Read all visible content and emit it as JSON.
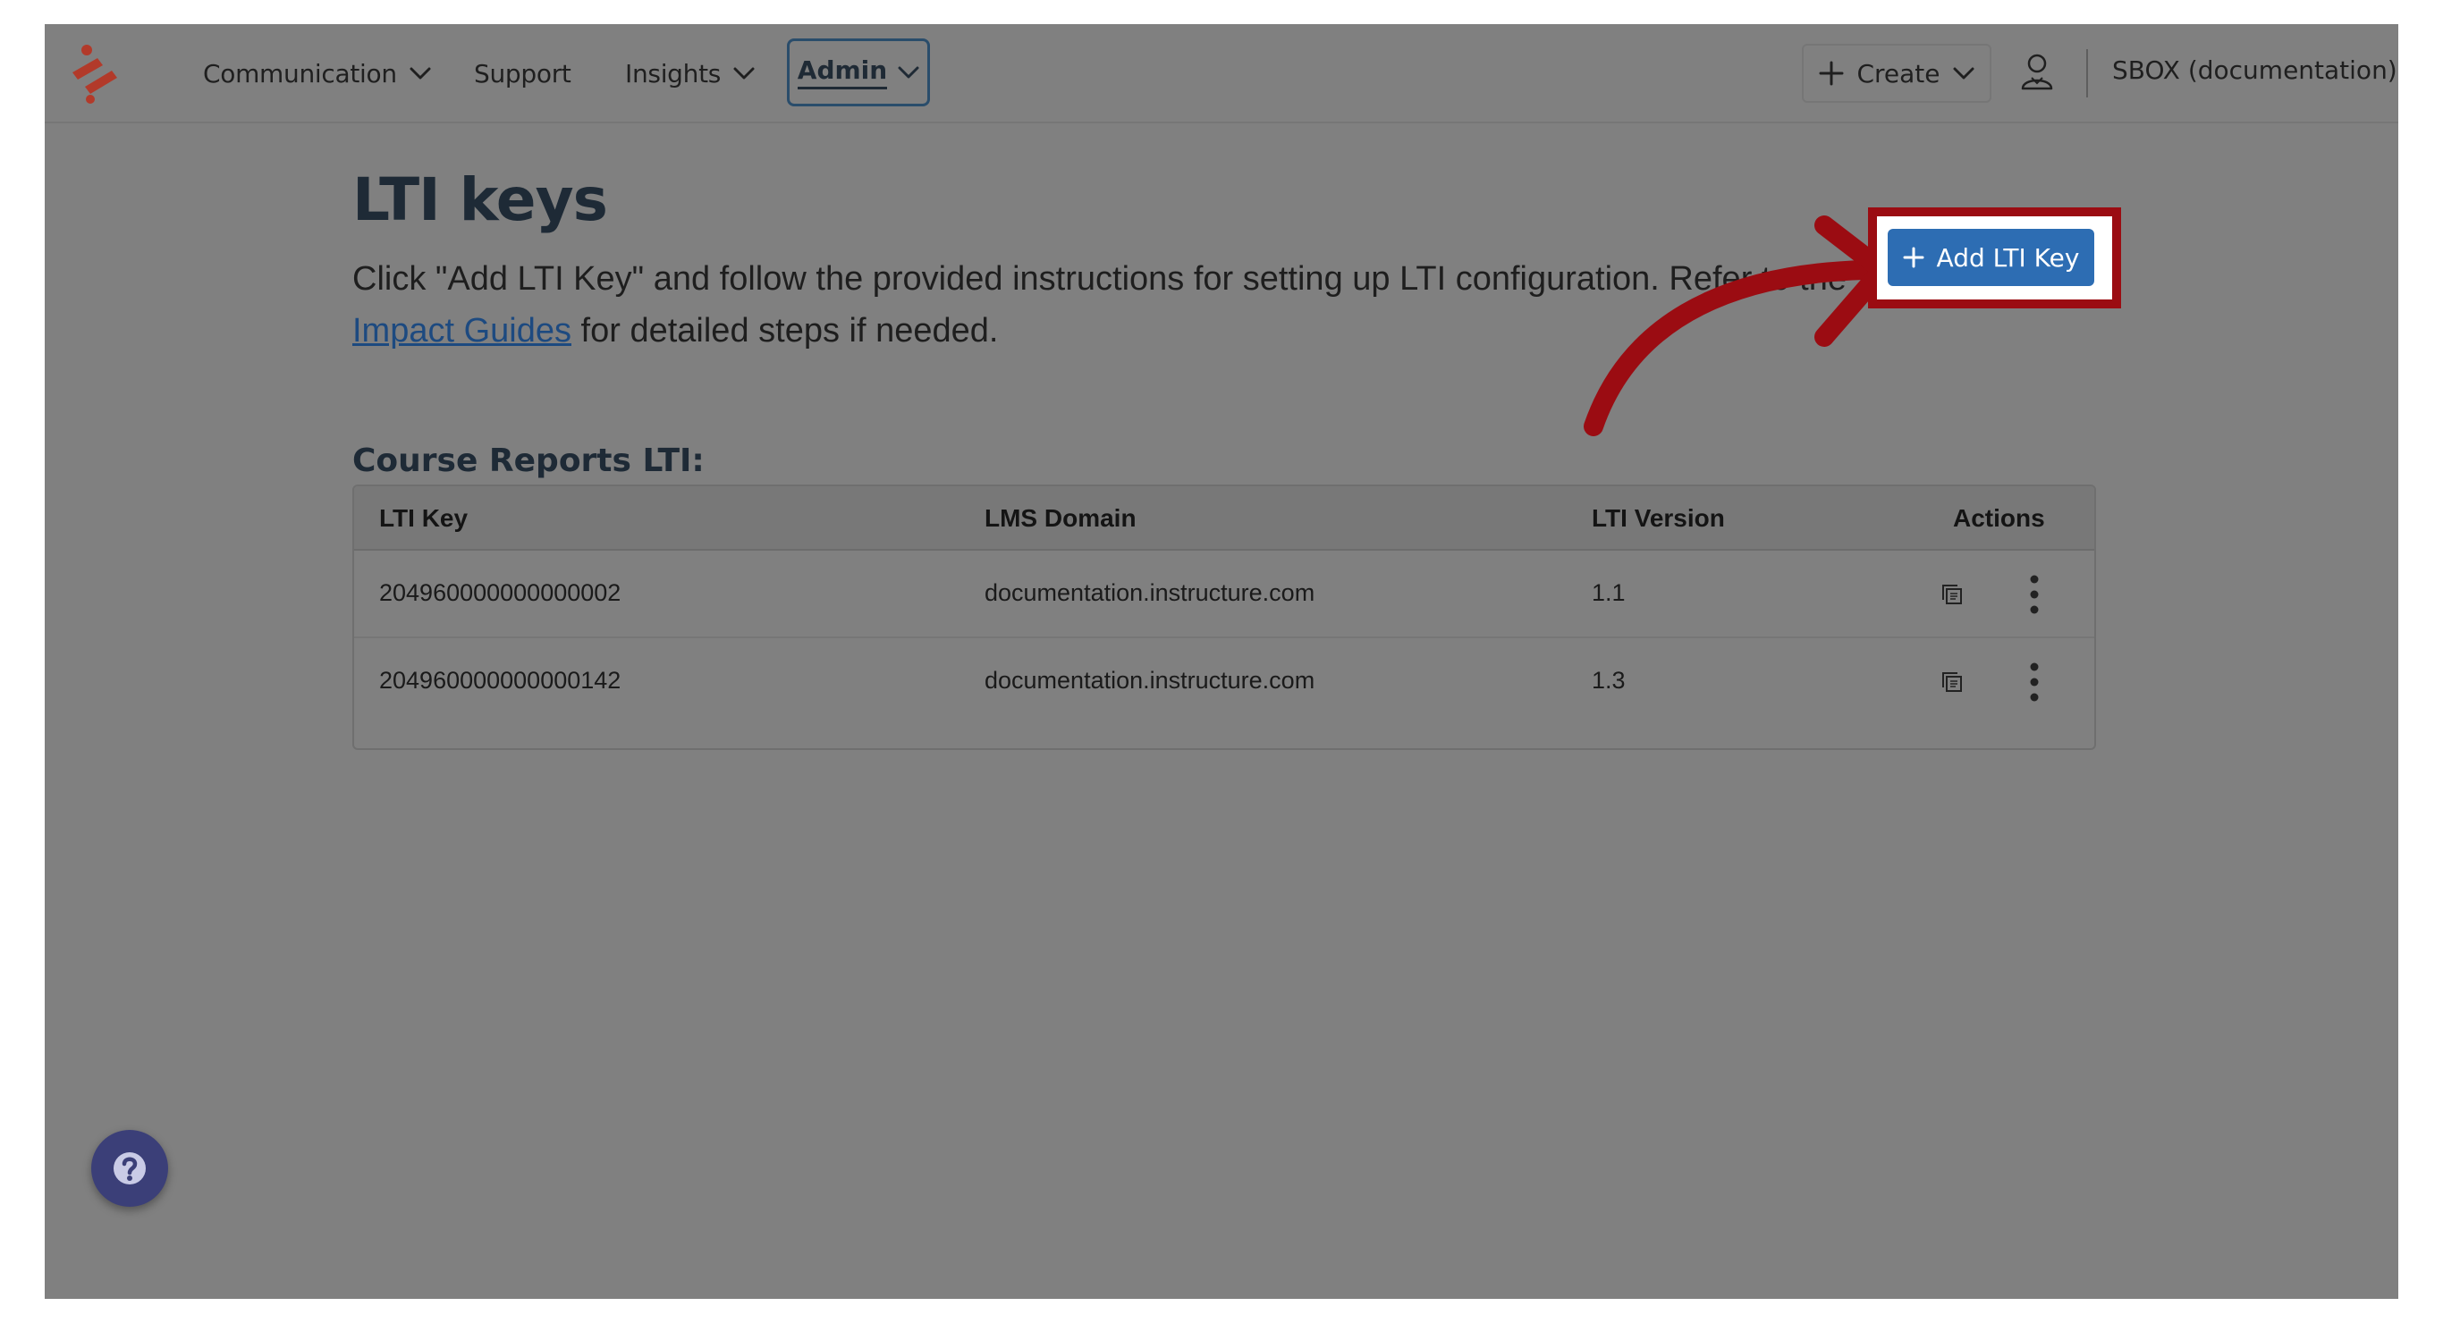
{
  "nav": {
    "items": [
      {
        "label": "Communication",
        "has_dropdown": true
      },
      {
        "label": "Support",
        "has_dropdown": false
      },
      {
        "label": "Insights",
        "has_dropdown": true
      }
    ],
    "admin": {
      "label": "Admin",
      "active": true
    },
    "create_label": "Create",
    "account_name": "SBOX (documentation)"
  },
  "page": {
    "title": "LTI keys",
    "intro_before_link": "Click \"Add LTI Key\" and follow the provided instructions for setting up LTI configuration. Refer to the ",
    "link_text": "Impact Guides",
    "intro_after_link": " for detailed steps if needed.",
    "add_button_label": "Add LTI Key",
    "section_heading": "Course Reports LTI:"
  },
  "table": {
    "headers": [
      "LTI Key",
      "LMS Domain",
      "LTI Version",
      "Actions"
    ],
    "rows": [
      {
        "key": "204960000000000002",
        "domain": "documentation.instructure.com",
        "version": "1.1"
      },
      {
        "key": "204960000000000142",
        "domain": "documentation.instructure.com",
        "version": "1.3"
      }
    ]
  },
  "colors": {
    "accent": "#2d6db3",
    "highlight": "#9b0c12",
    "help": "#3b3f78",
    "logo": "#b23a2a"
  },
  "icons": {
    "logo": "impact-logo-icon",
    "user": "user-icon",
    "copy": "copy-icon",
    "more": "kebab-menu-icon",
    "help": "help-icon",
    "arrow": "callout-arrow-icon"
  }
}
